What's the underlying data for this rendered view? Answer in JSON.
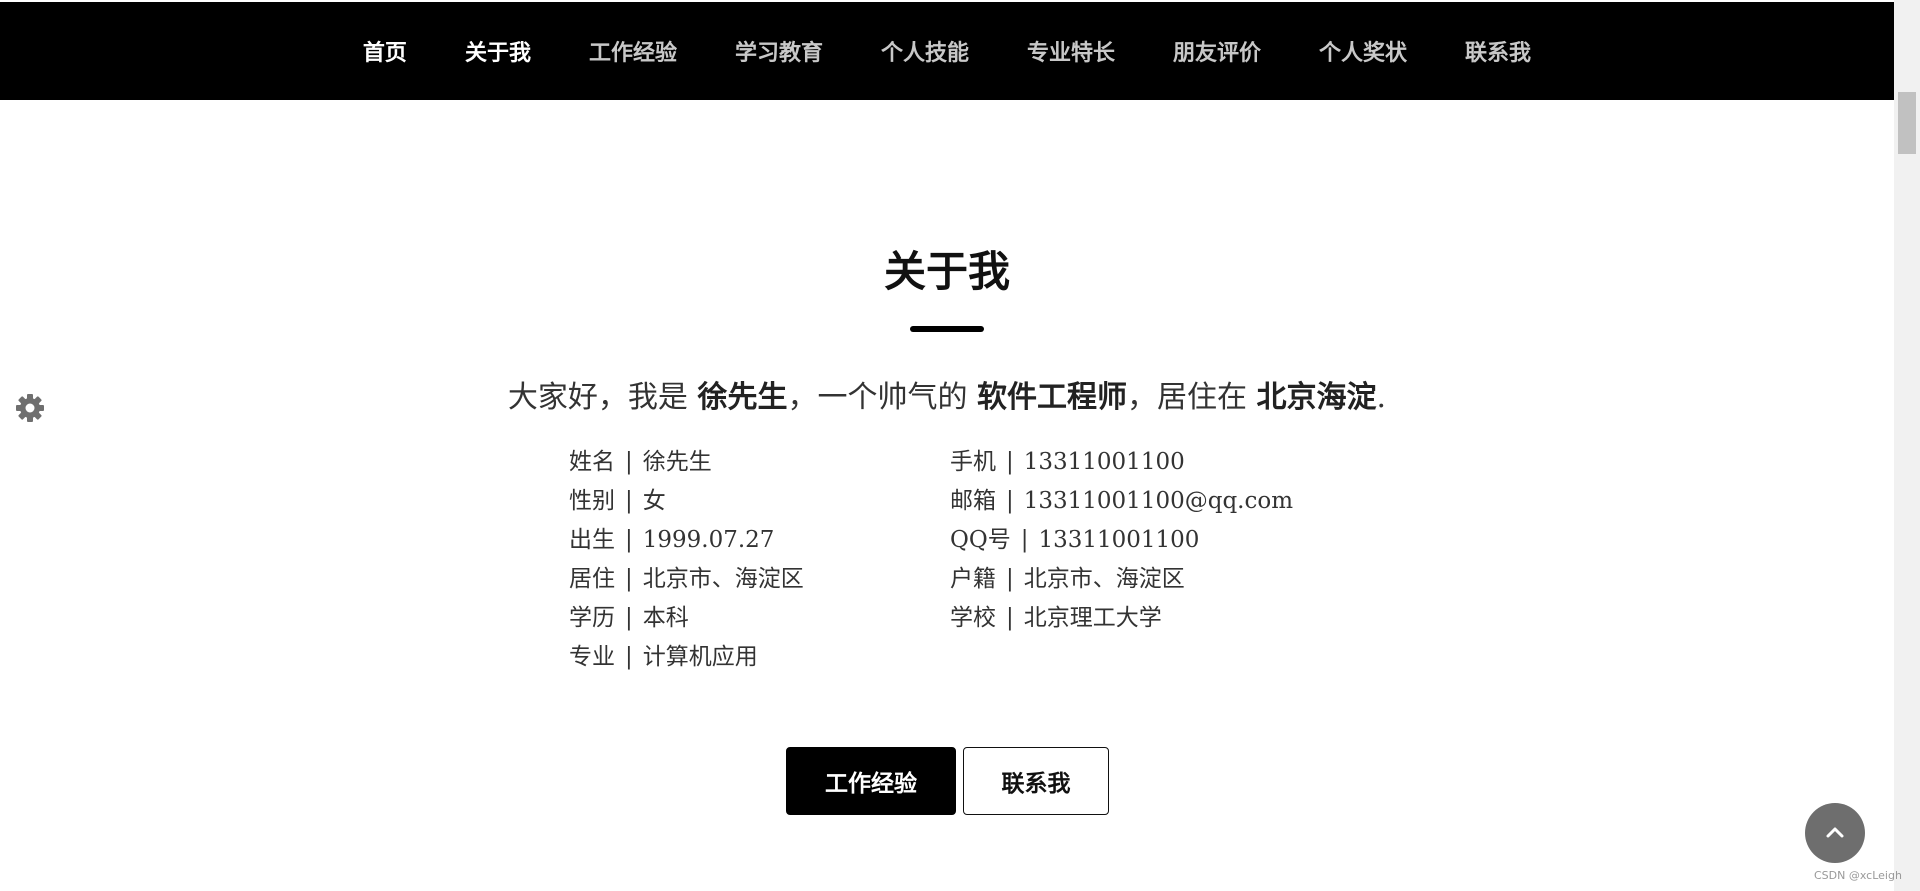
{
  "nav": {
    "items": [
      {
        "label": "首页"
      },
      {
        "label": "关于我"
      },
      {
        "label": "工作经验"
      },
      {
        "label": "学习教育"
      },
      {
        "label": "个人技能"
      },
      {
        "label": "专业特长"
      },
      {
        "label": "朋友评价"
      },
      {
        "label": "个人奖状"
      },
      {
        "label": "联系我"
      }
    ]
  },
  "about": {
    "title": "关于我",
    "intro": {
      "p1": "大家好，我是 ",
      "name": "徐先生",
      "p2": "，一个帅气的 ",
      "job": "软件工程师",
      "p3": "，居住在 ",
      "city": "北京海淀",
      "p4": "."
    },
    "separator": "|",
    "left": [
      {
        "label": "姓名",
        "value": "徐先生"
      },
      {
        "label": "性别",
        "value": "女"
      },
      {
        "label": "出生",
        "value": "1999.07.27"
      },
      {
        "label": "居住",
        "value": "北京市、海淀区"
      },
      {
        "label": "学历",
        "value": "本科"
      },
      {
        "label": "专业",
        "value": "计算机应用"
      }
    ],
    "right": [
      {
        "label": "手机",
        "value": "13311001100"
      },
      {
        "label": "邮箱",
        "value": "13311001100@qq.com"
      },
      {
        "label": "QQ号",
        "value": "13311001100"
      },
      {
        "label": "户籍",
        "value": "北京市、海淀区"
      },
      {
        "label": "学校",
        "value": "北京理工大学"
      }
    ],
    "buttons": {
      "primary": "工作经验",
      "secondary": "联系我"
    }
  },
  "icons": {
    "settings": "gear-icon",
    "back_to_top": "chevron-up-icon"
  },
  "watermark": "CSDN @xcLeigh",
  "colors": {
    "nav_bg": "#000000",
    "nav_active": "#ffffff",
    "nav_inactive": "#c8c8c8",
    "back_to_top_bg": "#6e6e6e"
  }
}
